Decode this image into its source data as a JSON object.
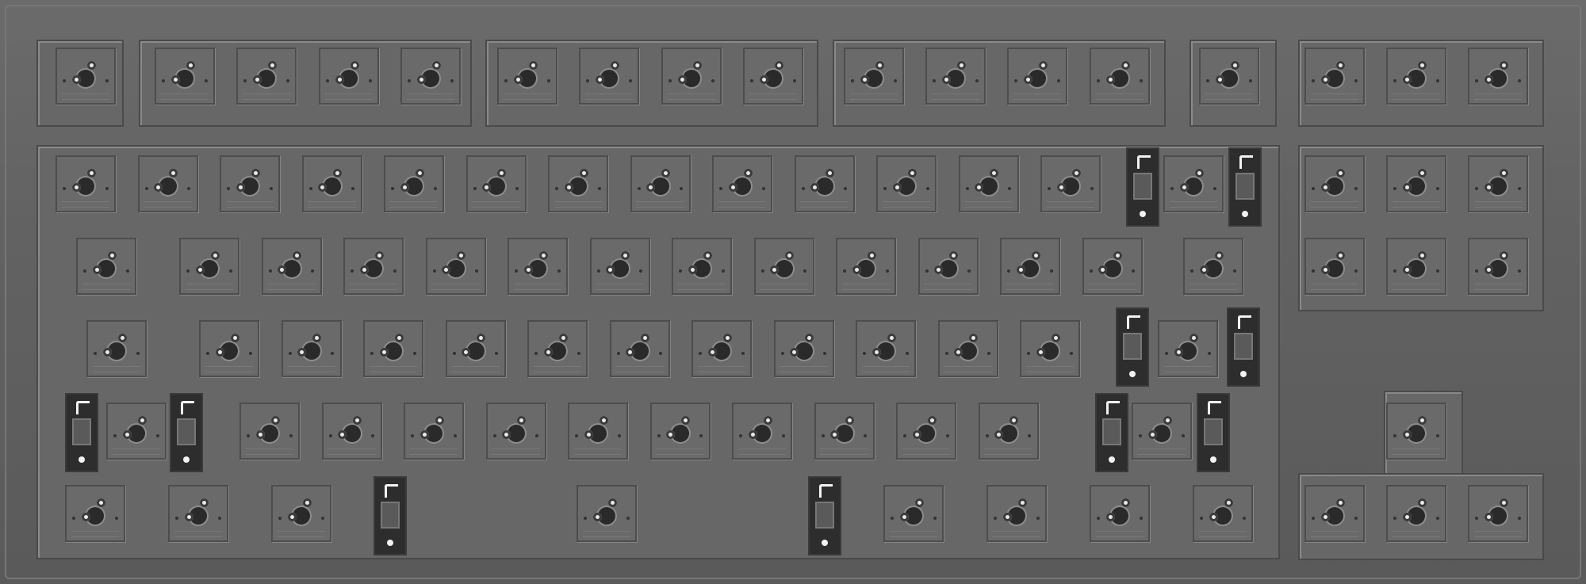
{
  "colors": {
    "frame": "#626262",
    "plate": "#676767",
    "socket": "#6a6a6a",
    "hole": "#2a2a2a",
    "pin": "#e8e8e8",
    "stabilizer": "#2d2d2d"
  },
  "elements": {
    "keyboard": "keyboard-pcb-plate",
    "socket": "hotswap-switch-socket",
    "stabilizer": "stabilizer"
  }
}
